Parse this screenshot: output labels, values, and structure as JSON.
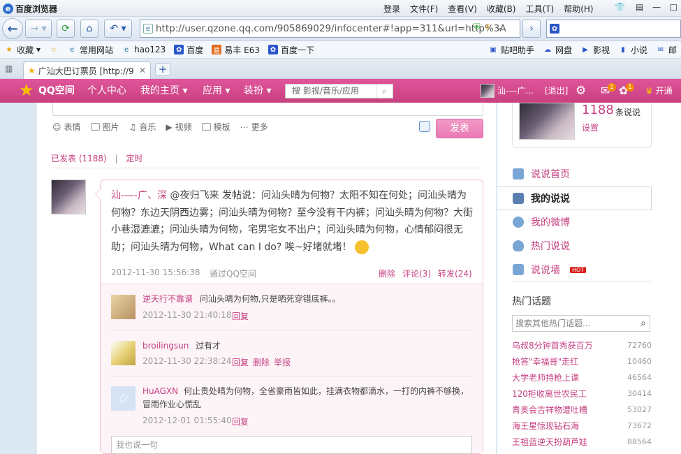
{
  "browser": {
    "title": "百度浏览器",
    "menu": [
      "登录",
      "文件(F)",
      "查看(V)",
      "收藏(B)",
      "工具(T)",
      "帮助(H)"
    ],
    "url": "http://user.qzone.qq.com/905869029/infocenter#!app=311&url=http%3A",
    "favorites": [
      "收藏",
      "常用网站",
      "hao123",
      "百度",
      "易丰 E63",
      "百度一下",
      "贴吧助手",
      "网盘",
      "影视",
      "小说",
      "邮"
    ],
    "tab_title": "广汕大巴订票员 [http://9"
  },
  "qzone": {
    "brand": "QQ空间",
    "nav": [
      "个人中心",
      "我的主页 ▾",
      "应用 ▾",
      "装扮 ▾"
    ],
    "search_placeholder": "搜 影视/音乐/应用",
    "user": "汕-—广...",
    "logout": "[退出]",
    "badge1": "1",
    "badge2": "1",
    "vip": "开通"
  },
  "composer": {
    "tools": [
      "表情",
      "图片",
      "音乐",
      "视频",
      "模板",
      "更多"
    ],
    "post_button": "发表"
  },
  "tabs": {
    "published": "已发表 (1188)",
    "sep": "|",
    "scheduled": "定时"
  },
  "post": {
    "author": "汕-—-广、深",
    "text": " @夜归飞来 发帖说：问汕头晴为何物？太阳不知在何处；问汕头晴为何物？东边天阴西边雾；问汕头晴为何物？至今没有干内裤；问汕头晴为何物？大街小巷湿漉漉；问汕头晴为何物，宅男宅女不出户；问汕头晴为何物，心情郁闷很无助；问汕头晴为何物，What can I do? 唉~好堵就堵！",
    "time": "2012-11-30 15:56:38",
    "via": "通过QQ空间",
    "delete": "删除",
    "comment": "评论(3)",
    "forward": "转发(24)"
  },
  "comments": [
    {
      "name": "逆天行不靠谱",
      "text": "问汕头晴为何物,只是晒死穿错底裤。。",
      "time": "2012-11-30 21:40:18",
      "actions": [
        "回复"
      ]
    },
    {
      "name": "broilingsun",
      "text": "过有才",
      "time": "2012-11-30 22:38:24",
      "actions": [
        "回复",
        "删除",
        "举报"
      ]
    },
    {
      "name": "HuAGXN",
      "text": "何止贵处晴为何物，全省豪雨皆如此，挂满衣物都滴水，一打的内裤不够换，冒雨作业心慌乱",
      "time": "2012-12-01 01:55:40",
      "actions": [
        "回复"
      ]
    }
  ],
  "reply_placeholder": "我也说一句",
  "sidebar": {
    "count": "1188",
    "count_label": "条说说",
    "settings": "设置",
    "nav": [
      "说说首页",
      "我的说说",
      "我的微博",
      "热门说说",
      "说说墙"
    ],
    "hot_badge": "HOT",
    "hot_title": "热门话题",
    "hot_search": "搜索其他热门话题...",
    "hot": [
      {
        "t": "乌叔8分钟首秀获百万",
        "n": "72760"
      },
      {
        "t": "抢答\"幸福哥\"走红",
        "n": "10460"
      },
      {
        "t": "大学老师持枪上课",
        "n": "46564"
      },
      {
        "t": "120拒收离世农民工",
        "n": "30414"
      },
      {
        "t": "青奥会吉祥物遭吐槽",
        "n": "53027"
      },
      {
        "t": "海王星惊现钻石海",
        "n": "73672"
      },
      {
        "t": "王祖蓝逆天扮葫芦娃",
        "n": "88564"
      }
    ]
  }
}
